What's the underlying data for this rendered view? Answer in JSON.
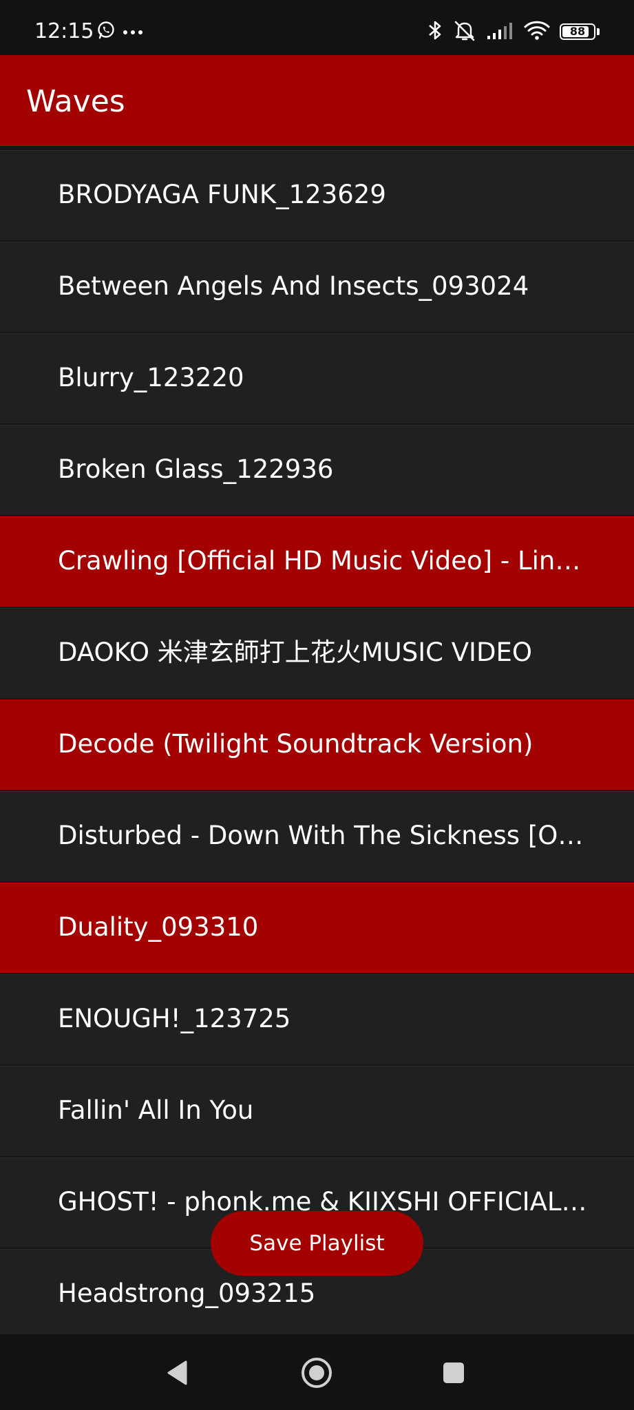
{
  "status_bar": {
    "time": "12:15",
    "left_icons": [
      "whatsapp-icon",
      "more-dots-icon"
    ],
    "right_icons": [
      "bluetooth-icon",
      "muted-bell-icon",
      "signal-icon",
      "wifi-icon",
      "battery-icon"
    ],
    "battery_level": "88"
  },
  "app_bar": {
    "title": "Waves"
  },
  "songs": [
    {
      "title": "BRODYAGA FUNK_123629",
      "selected": false
    },
    {
      "title": "Between Angels And Insects_093024",
      "selected": false
    },
    {
      "title": "Blurry_123220",
      "selected": false
    },
    {
      "title": "Broken Glass_122936",
      "selected": false
    },
    {
      "title": "Crawling [Official HD Music Video] - Linkin Park",
      "selected": true
    },
    {
      "title": "DAOKO  米津玄師打上花火MUSIC VIDEO",
      "selected": false
    },
    {
      "title": "Decode (Twilight Soundtrack Version)",
      "selected": true
    },
    {
      "title": "Disturbed - Down With The Sickness [Official Music Video]",
      "selected": false
    },
    {
      "title": "Duality_093310",
      "selected": true
    },
    {
      "title": "ENOUGH!_123725",
      "selected": false
    },
    {
      "title": "Fallin' All In You",
      "selected": false
    },
    {
      "title": "GHOST! - phonk.me & KIIXSHI  OFFICIAL VIDEO",
      "selected": false
    },
    {
      "title": "Headstrong_093215",
      "selected": false
    }
  ],
  "save_button": {
    "label": "Save Playlist"
  },
  "nav_bar": {
    "buttons": [
      "back-icon",
      "home-icon",
      "recents-icon"
    ]
  },
  "colors": {
    "accent": "#a30000",
    "row_background": "#202020",
    "text": "#ffffff"
  }
}
